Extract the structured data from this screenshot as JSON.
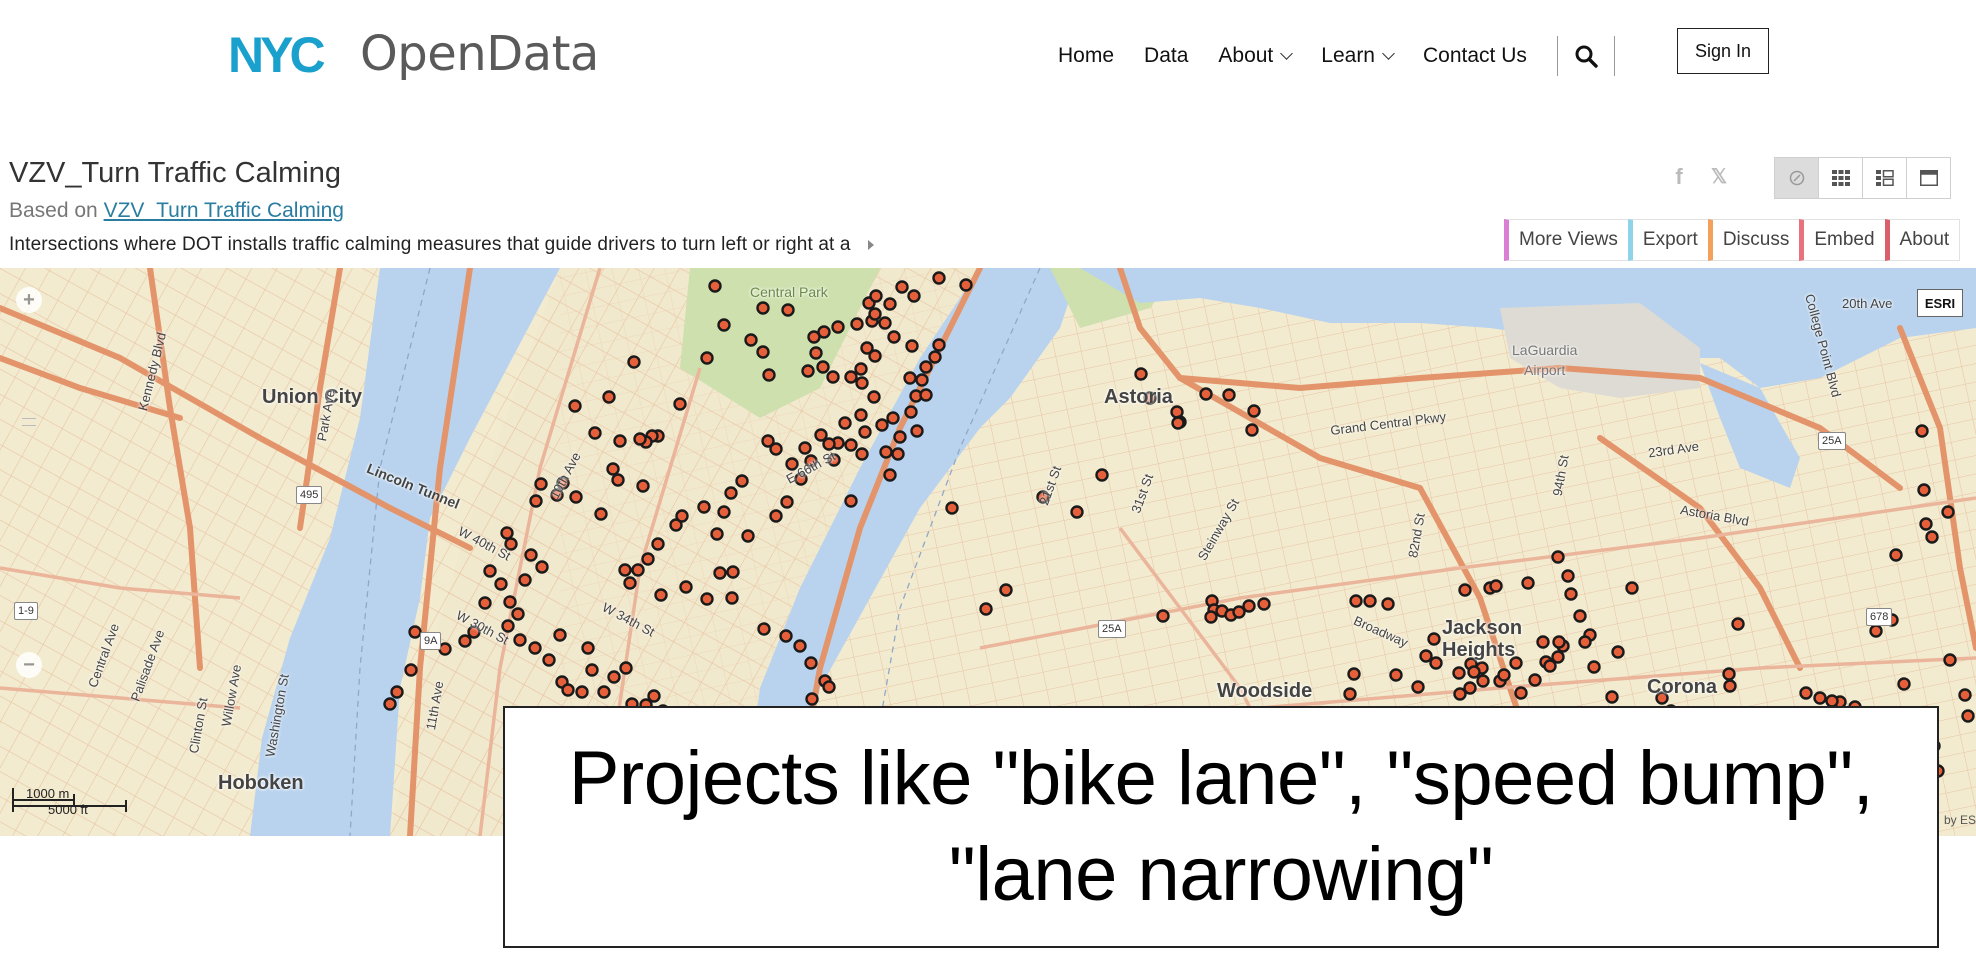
{
  "brand": {
    "logo_mark": "NYC",
    "logo_text": "OpenData",
    "logo_color": "#1aa0cc"
  },
  "nav": {
    "items": [
      {
        "label": "Home",
        "dropdown": false
      },
      {
        "label": "Data",
        "dropdown": false
      },
      {
        "label": "About",
        "dropdown": true
      },
      {
        "label": "Learn",
        "dropdown": true
      },
      {
        "label": "Contact Us",
        "dropdown": false
      }
    ],
    "search_icon": "search-icon",
    "sign_in_label": "Sign In"
  },
  "dataset": {
    "title": "VZV_Turn Traffic Calming",
    "based_on_prefix": "Based on ",
    "based_on_link": "VZV_Turn Traffic Calming",
    "description": "Intersections where DOT installs traffic calming measures that guide drivers to turn left or right at a"
  },
  "social": {
    "facebook_glyph": "f",
    "x_glyph": "𝕏"
  },
  "view_toggle": {
    "buttons": [
      "visualization-view-icon",
      "grid-view-icon",
      "split-view-icon",
      "page-view-icon"
    ],
    "active": "visualization-view-icon"
  },
  "actions": [
    {
      "label": "More Views",
      "color": "#d97fd5"
    },
    {
      "label": "Export",
      "color": "#8fd3ea"
    },
    {
      "label": "Discuss",
      "color": "#f3a15a"
    },
    {
      "label": "Embed",
      "color": "#e8737d"
    },
    {
      "label": "About",
      "color": "#d9606b"
    }
  ],
  "map": {
    "basemap_badge": "ESRI",
    "zoom_in": "+",
    "zoom_out": "−",
    "scale_metric": "1000 m",
    "scale_imperial": "5000 ft",
    "attribution": "by ESRI",
    "water_color": "#b9d3ee",
    "land_color": "#f2ebcf",
    "park_color": "#cde0ad",
    "road_color": "#e8a27a",
    "marker_fill": "#e5603a",
    "places": [
      {
        "label": "Union City"
      },
      {
        "label": "Hoboken"
      },
      {
        "label": "Astoria"
      },
      {
        "label": "Jackson"
      },
      {
        "label": "Heights"
      },
      {
        "label": "Woodside"
      },
      {
        "label": "Corona"
      },
      {
        "label": "Central Park"
      },
      {
        "label": "LaGuardia"
      },
      {
        "label": "Airport"
      },
      {
        "label": "Lincoln Tunnel"
      },
      {
        "label": "Grand Central Pkwy"
      },
      {
        "label": "Astoria Blvd"
      },
      {
        "label": "20th Ave"
      },
      {
        "label": "23rd Ave"
      },
      {
        "label": "Broadway"
      },
      {
        "label": "21st St"
      },
      {
        "label": "31st St"
      },
      {
        "label": "Steinway St"
      },
      {
        "label": "82nd St"
      },
      {
        "label": "94th St"
      },
      {
        "label": "E 66th St"
      },
      {
        "label": "W 34th St"
      },
      {
        "label": "W 30th St"
      },
      {
        "label": "W 40th St"
      },
      {
        "label": "10th Ave"
      },
      {
        "label": "11th Ave"
      },
      {
        "label": "Park Ave"
      },
      {
        "label": "Central Ave"
      },
      {
        "label": "Palisade Ave"
      },
      {
        "label": "Willow Ave"
      },
      {
        "label": "Washington St"
      },
      {
        "label": "Clinton St"
      },
      {
        "label": "Kennedy Blvd"
      },
      {
        "label": "College Point Blvd"
      }
    ],
    "route_shields": [
      "495",
      "9A",
      "25A",
      "1-9",
      "25A",
      "678"
    ]
  },
  "caption": {
    "text": "Projects like \"bike lane\", \"speed bump\", \"lane narrowing\""
  }
}
